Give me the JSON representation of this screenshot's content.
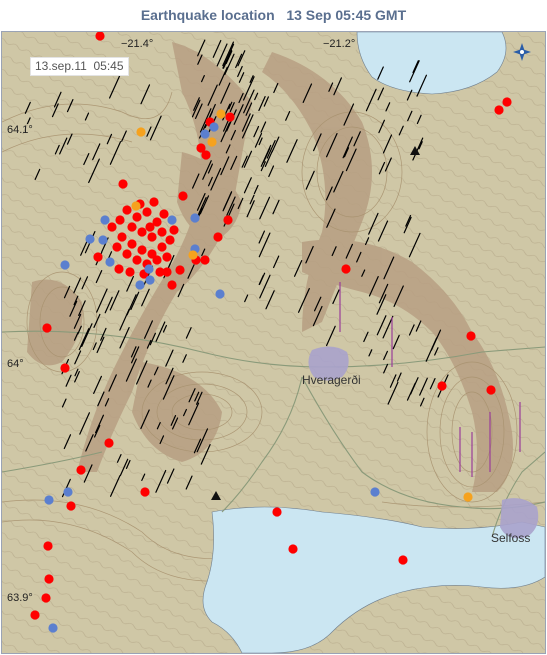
{
  "header": {
    "title": "Earthquake location   13 Sep 05:45 GMT"
  },
  "map": {
    "timestamp": "13.sep.11  05:45",
    "coordinates": {
      "lon_214": "−21.4°",
      "lon_212": "−21.2°",
      "lat_641": "64.1°",
      "lat_640": "64°",
      "lat_639": "63.9°"
    },
    "towns": {
      "hveragerdi": "Hveragerði",
      "selfoss": "Selfoss"
    },
    "colors": {
      "land": "#cfc7a6",
      "contours": "#a8926f",
      "highland": "#b79f82",
      "water": "#cbe6f2",
      "faults": "#000000",
      "quake_recent": "#ff0000",
      "quake_hours": "#f6a21e",
      "quake_old": "#5b7fcf",
      "town_fill": "#a8a2cc"
    },
    "icons": [
      "compass-icon",
      "volcano-triangle-icon"
    ]
  }
}
